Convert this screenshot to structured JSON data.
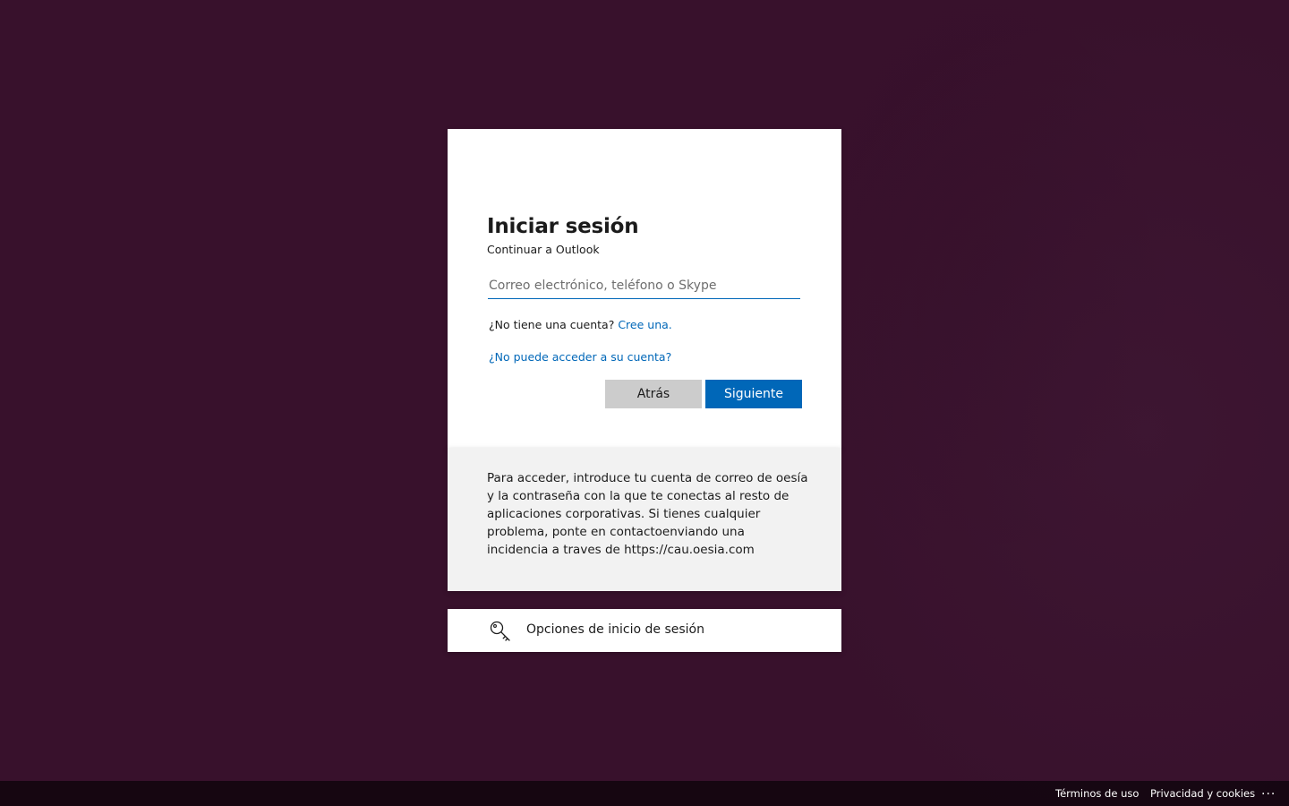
{
  "signin": {
    "title": "Iniciar sesión",
    "subtitle": "Continuar a Outlook",
    "email_placeholder": "Correo electrónico, teléfono o Skype",
    "email_value": "",
    "no_account_text": "¿No tiene una cuenta?",
    "create_link": "Cree una.",
    "cant_access_link": "¿No puede acceder a su cuenta?",
    "back_button": "Atrás",
    "next_button": "Siguiente"
  },
  "info": {
    "text": "Para acceder, introduce tu cuenta de correo de oesía y la contraseña con la que te conectas al resto de aplicaciones corporativas. Si tienes cualquier problema, ponte en contactoenviando una incidencia a traves de https://cau.oesia.com"
  },
  "signin_options": {
    "icon": "key-icon",
    "label": "Opciones de inicio de sesión"
  },
  "footer": {
    "terms": "Términos de uso",
    "privacy": "Privacidad y cookies",
    "more": "..."
  },
  "colors": {
    "background": "#38112c",
    "accent": "#0067b8",
    "back_button_bg": "#cccccc",
    "info_bg": "#f2f2f2"
  }
}
